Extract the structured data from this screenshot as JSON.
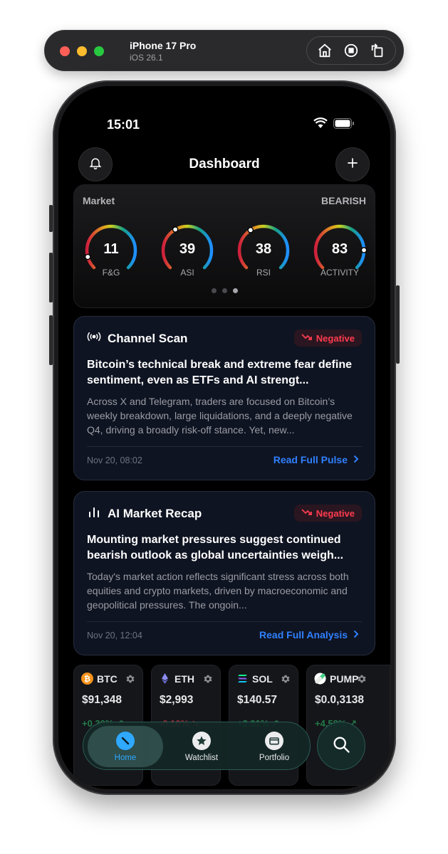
{
  "simulator": {
    "device_name": "iPhone 17 Pro",
    "os_version": "iOS 26.1",
    "actions": [
      "home-icon",
      "screenshot-icon",
      "rotate-icon"
    ]
  },
  "status_bar": {
    "time": "15:01"
  },
  "header": {
    "title": "Dashboard",
    "left_icon": "bell-icon",
    "right_icon": "plus-icon"
  },
  "market": {
    "label": "Market",
    "sentiment": "BEARISH",
    "gauges": [
      {
        "label": "F&G",
        "value": "11",
        "fraction": 0.11
      },
      {
        "label": "ASI",
        "value": "39",
        "fraction": 0.39
      },
      {
        "label": "RSI",
        "value": "38",
        "fraction": 0.38
      },
      {
        "label": "ACTIVITY",
        "value": "83",
        "fraction": 0.83
      }
    ],
    "page_count": 3,
    "active_page": 2
  },
  "channel_scan": {
    "title": "Channel Scan",
    "badge": "Negative",
    "headline": "Bitcoin’s technical break and extreme fear define sentiment, even as ETFs and AI strengt...",
    "body": "Across X and Telegram, traders are focused on Bitcoin’s weekly breakdown, large liquidations, and a deeply negative Q4, driving a broadly risk-off stance. Yet, new...",
    "timestamp": "Nov 20, 08:02",
    "link": "Read Full Pulse"
  },
  "market_recap": {
    "title": "AI Market Recap",
    "badge": "Negative",
    "headline": "Mounting market pressures suggest continued bearish outlook as global uncertainties weigh...",
    "body": "Today's market action reflects significant stress across both equities and crypto markets, driven by macroeconomic and geopolitical pressures. The ongoin...",
    "timestamp": "Nov 20, 12:04",
    "link": "Read Full Analysis"
  },
  "coins": [
    {
      "symbol": "BTC",
      "price": "$91,348",
      "change": "+0.30% ↗",
      "color": "#f7931a",
      "direction": "up"
    },
    {
      "symbol": "ETH",
      "price": "$2,993",
      "change": "-0.10% ↘",
      "color": "#8c8cf0",
      "direction": "down"
    },
    {
      "symbol": "SOL",
      "price": "$140.57",
      "change": "+2.91% ↗",
      "color": "#14f195",
      "direction": "up"
    },
    {
      "symbol": "PUMP",
      "price": "$0.0,3138",
      "change": "+4.58% ↗",
      "color": "#48d18a",
      "direction": "up"
    }
  ],
  "tabbar": {
    "tabs": [
      {
        "label": "Home",
        "icon": "compass-icon",
        "active": true
      },
      {
        "label": "Watchlist",
        "icon": "star-icon",
        "active": false
      },
      {
        "label": "Portfolio",
        "icon": "wallet-icon",
        "active": false
      }
    ],
    "search_icon": "search-icon"
  },
  "colors": {
    "accent_blue": "#2f80ff",
    "negative": "#ff3b4f",
    "positive": "#2ecc71",
    "card_bg": "#0f1422"
  }
}
